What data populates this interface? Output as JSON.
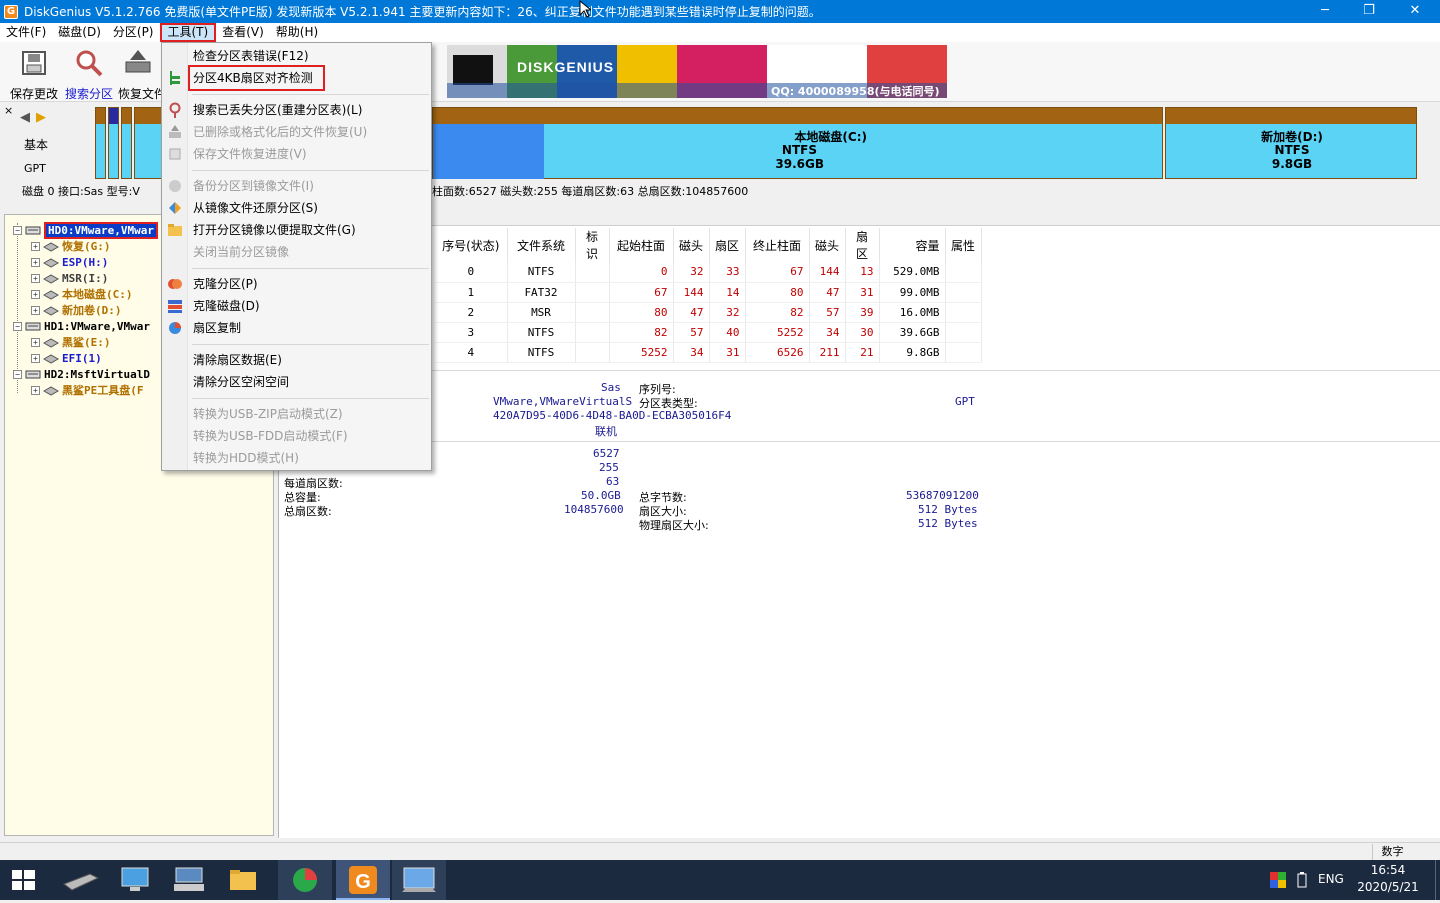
{
  "titlebar": {
    "app_icon": "G",
    "title": "DiskGenius V5.1.2.766 免费版(单文件PE版)   发现新版本 V5.2.1.941 主要更新内容如下：26、纠正复制文件功能遇到某些错误时停止复制的问题。",
    "minimize": "─",
    "restore": "❐",
    "close": "✕"
  },
  "menu": {
    "file": "文件(F)",
    "disk": "磁盘(D)",
    "partition": "分区(P)",
    "tools": "工具(T)",
    "view": "查看(V)",
    "help": "帮助(H)"
  },
  "toolbar": {
    "save": "保存更改",
    "search": "搜索分区",
    "recover": "恢复文件"
  },
  "banner": {
    "brand": "DISKGENIUS",
    "qq": "QQ: 4000089958(与电话同号)"
  },
  "diskbar": {
    "nav_prev": "◀",
    "nav_next": "▶",
    "basic": "基本",
    "gpt": "GPT",
    "c_name": "本地磁盘(C:)",
    "c_fs": "NTFS",
    "c_size": "39.6GB",
    "d_name": "新加卷(D:)",
    "d_fs": "NTFS",
    "d_size": "9.8GB",
    "info_left": "磁盘 0 接口:Sas  型号:V",
    "info_right": "柱面数:6527   磁头数:255   每道扇区数:63   总扇区数:104857600"
  },
  "tree": [
    {
      "label": "HD0:VMware,VMwar",
      "color": "#ffffff",
      "selected": true
    },
    {
      "label": "恢复(G:)",
      "color": "#b07000"
    },
    {
      "label": "ESP(H:)",
      "color": "#1a1ad0"
    },
    {
      "label": "MSR(I:)",
      "color": "#404040"
    },
    {
      "label": "本地磁盘(C:)",
      "color": "#b07000"
    },
    {
      "label": "新加卷(D:)",
      "color": "#b07000"
    },
    {
      "label": "HD1:VMware,VMwar",
      "color": "#000000"
    },
    {
      "label": "黑鲨(E:)",
      "color": "#b07000"
    },
    {
      "label": "EFI(1)",
      "color": "#1a1ad0"
    },
    {
      "label": "HD2:MsftVirtualD",
      "color": "#000000"
    },
    {
      "label": "黑鲨PE工具盘(F",
      "color": "#b07000"
    }
  ],
  "table": {
    "headers": [
      "序号(状态)",
      "文件系统",
      "标识",
      "起始柱面",
      "磁头",
      "扇区",
      "终止柱面",
      "磁头",
      "扇区",
      "容量",
      "属性"
    ],
    "rows": [
      [
        "0",
        "NTFS",
        "",
        "0",
        "32",
        "33",
        "67",
        "144",
        "13",
        "529.0MB",
        ""
      ],
      [
        "1",
        "FAT32",
        "",
        "67",
        "144",
        "14",
        "80",
        "47",
        "31",
        "99.0MB",
        ""
      ],
      [
        "2",
        "MSR",
        "",
        "80",
        "47",
        "32",
        "82",
        "57",
        "39",
        "16.0MB",
        ""
      ],
      [
        "3",
        "NTFS",
        "",
        "82",
        "57",
        "40",
        "5252",
        "34",
        "30",
        "39.6GB",
        ""
      ],
      [
        "4",
        "NTFS",
        "",
        "5252",
        "34",
        "31",
        "6526",
        "211",
        "21",
        "9.8GB",
        ""
      ]
    ]
  },
  "details": {
    "interface_val": "Sas",
    "serial_label": "序列号:",
    "model_val": "VMware,VMwareVirtualS",
    "pt_type_label": "分区表类型:",
    "pt_type_val": "GPT",
    "guid_val": "420A7D95-40D6-4D48-BA0D-ECBA305016F4",
    "status_val": "联机",
    "cyl_val": "6527",
    "heads_val": "255",
    "spt_label": "每道扇区数:",
    "spt_val": "63",
    "capacity_label": "总容量:",
    "capacity_val": "50.0GB",
    "total_bytes_label": "总字节数:",
    "total_bytes_val": "53687091200",
    "total_sectors_label": "总扇区数:",
    "total_sectors_val": "104857600",
    "sector_size_label": "扇区大小:",
    "sector_size_val": "512 Bytes",
    "phys_sector_label": "物理扇区大小:",
    "phys_sector_val": "512 Bytes"
  },
  "dropdown": [
    {
      "label": "检查分区表错误(F12)",
      "disabled": false
    },
    {
      "label": "分区4KB扇区对齐检测",
      "disabled": false,
      "highlight": true
    },
    {
      "label": "搜索已丢失分区(重建分区表)(L)",
      "disabled": false
    },
    {
      "label": "已删除或格式化后的文件恢复(U)",
      "disabled": true
    },
    {
      "label": "保存文件恢复进度(V)",
      "disabled": true
    },
    {
      "label": "备份分区到镜像文件(I)",
      "disabled": true
    },
    {
      "label": "从镜像文件还原分区(S)",
      "disabled": false
    },
    {
      "label": "打开分区镜像以便提取文件(G)",
      "disabled": false
    },
    {
      "label": "关闭当前分区镜像",
      "disabled": true
    },
    {
      "label": "克隆分区(P)",
      "disabled": false
    },
    {
      "label": "克隆磁盘(D)",
      "disabled": false
    },
    {
      "label": "扇区复制",
      "disabled": false
    },
    {
      "label": "清除扇区数据(E)",
      "disabled": false
    },
    {
      "label": "清除分区空闲空间",
      "disabled": false
    },
    {
      "label": "转换为USB-ZIP启动模式(Z)",
      "disabled": true
    },
    {
      "label": "转换为USB-FDD启动模式(F)",
      "disabled": true
    },
    {
      "label": "转换为HDD模式(H)",
      "disabled": true
    }
  ],
  "status": {
    "numlock": "数字"
  },
  "taskbar": {
    "lang": "ENG",
    "time": "16:54",
    "date": "2020/5/21"
  },
  "colors": {
    "titlebar": "#0078d7",
    "highlight_box": "#e02020",
    "partition_c": "#5ad3f5",
    "partition_header": "#a26412",
    "taskbar": "#1c2a40"
  }
}
